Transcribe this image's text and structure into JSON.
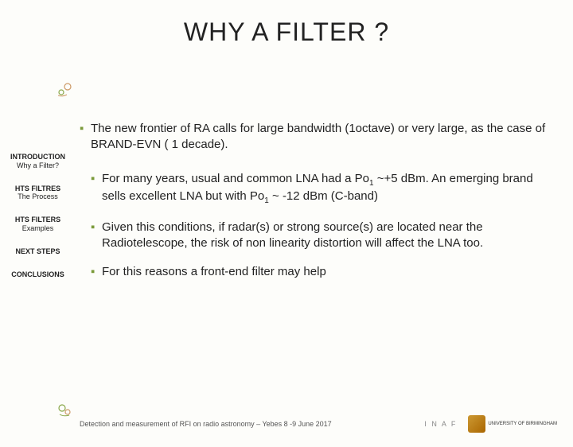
{
  "title": "WHY A FILTER ?",
  "sidebar": {
    "items": [
      {
        "head": "INTRODUCTION",
        "sub": "Why a Filter?"
      },
      {
        "head": "HTS FILTRES",
        "sub": "The Process"
      },
      {
        "head": "HTS FILTERS",
        "sub": "Examples"
      },
      {
        "head": "NEXT STEPS",
        "sub": ""
      },
      {
        "head": "CONCLUSIONS",
        "sub": ""
      }
    ]
  },
  "bullets": {
    "b1": "The new frontier of RA calls for large bandwidth (1octave) or very large, as the case of BRAND-EVN ( 1 decade).",
    "b2a": "For many years, usual and common LNA had a Po",
    "b2b": " ~+5 dBm. An emerging brand sells excellent LNA but with Po",
    "b2c": " ~ -12 dBm (C-band)",
    "b3": "Given this conditions, if radar(s) or strong source(s) are located near the Radiotelescope, the risk of non linearity distortion will affect the LNA too.",
    "b4": "For this reasons a front-end filter may help"
  },
  "footer": {
    "text": "Detection and measurement of RFI on radio astronomy – Yebes 8 -9 June 2017",
    "logo1": "I N A F",
    "logo2": "UNIVERSITY OF BIRMINGHAM"
  },
  "colors": {
    "accent": "#7a9a3a"
  }
}
